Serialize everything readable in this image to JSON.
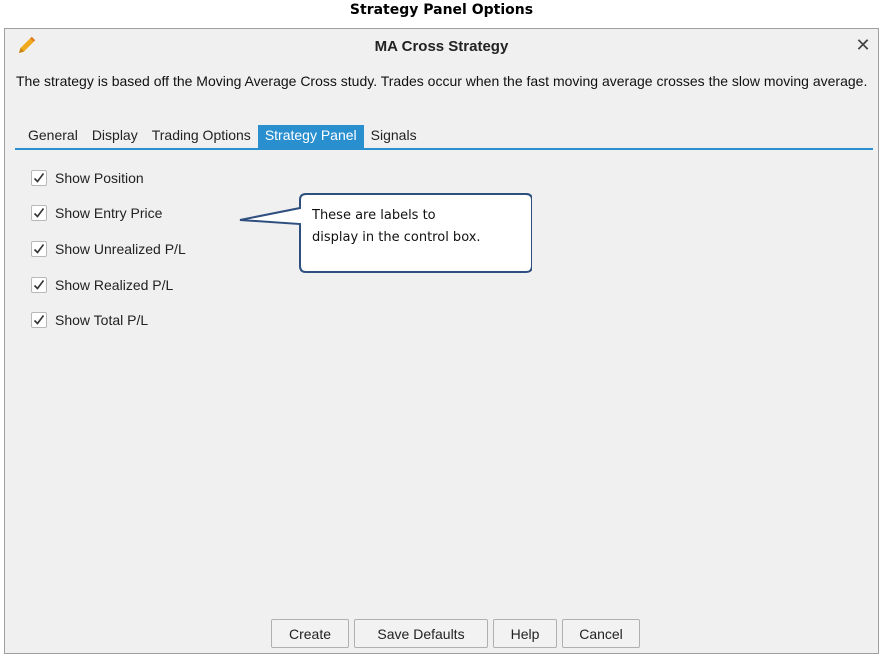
{
  "caption": "Strategy Panel Options",
  "window": {
    "title": "MA Cross Strategy",
    "close_label": "✕",
    "description": "The strategy is based off the Moving Average Cross study.  Trades occur when the fast moving average crosses the slow moving average."
  },
  "tabs": [
    {
      "label": "General",
      "active": false
    },
    {
      "label": "Display",
      "active": false
    },
    {
      "label": "Trading Options",
      "active": false
    },
    {
      "label": "Strategy Panel",
      "active": true
    },
    {
      "label": "Signals",
      "active": false
    }
  ],
  "options": [
    {
      "label": "Show Position",
      "checked": true
    },
    {
      "label": "Show Entry Price",
      "checked": true
    },
    {
      "label": "Show Unrealized P/L",
      "checked": true
    },
    {
      "label": "Show Realized P/L",
      "checked": true
    },
    {
      "label": "Show Total P/L",
      "checked": true
    }
  ],
  "callout": {
    "line1": "These are labels to",
    "line2": "display in the control box."
  },
  "buttons": {
    "create": "Create",
    "save_defaults": "Save Defaults",
    "help": "Help",
    "cancel": "Cancel"
  },
  "colors": {
    "accent": "#2a8fcf",
    "pencil": "#f0a81c"
  }
}
